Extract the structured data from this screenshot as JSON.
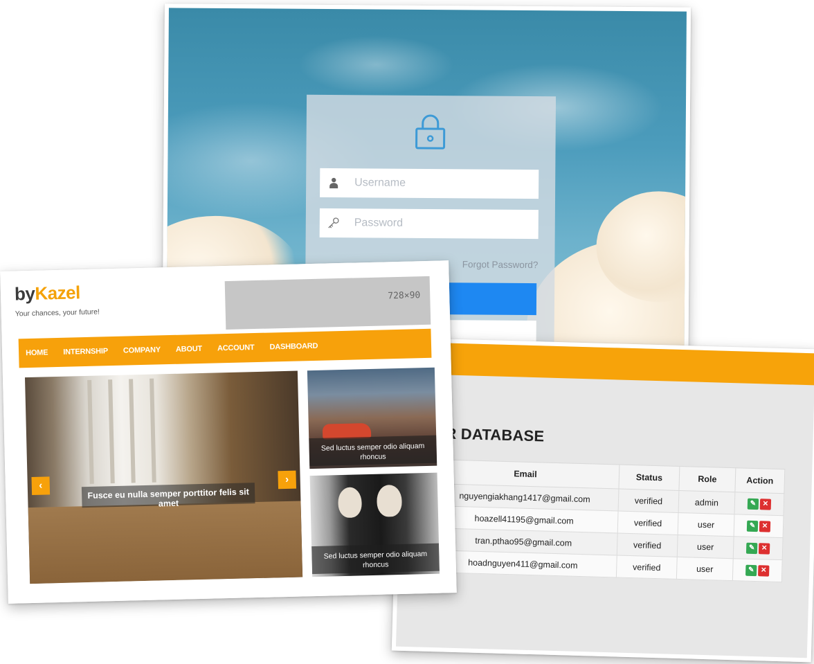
{
  "login": {
    "username_placeholder": "Username",
    "password_placeholder": "Password",
    "forgot_password": "Forgot Password?"
  },
  "database": {
    "title": "ER DATABASE",
    "columns": [
      "Email",
      "Status",
      "Role",
      "Action"
    ],
    "rows": [
      {
        "email": "nguyengiakhang1417@gmail.com",
        "status": "verified",
        "role": "admin"
      },
      {
        "email": "hoazell41195@gmail.com",
        "status": "verified",
        "role": "user"
      },
      {
        "email": "tran.pthao95@gmail.com",
        "status": "verified",
        "role": "user"
      },
      {
        "email": "hoadnguyen411@gmail.com",
        "status": "verified",
        "role": "user"
      }
    ]
  },
  "site": {
    "logo_by": "by",
    "logo_brand": "Kazel",
    "tagline": "Your chances, your future!",
    "ad_label": "728×90",
    "nav": [
      "HOME",
      "INTERNSHIP",
      "COMPANY",
      "ABOUT",
      "ACCOUNT",
      "DASHBOARD"
    ],
    "slide_caption": "Fusce eu nulla semper porttitor felis sit amet",
    "thumb_captions": [
      "Sed luctus semper odio aliquam rhoncus",
      "Sed luctus semper odio aliquam rhoncus"
    ],
    "prev_arrow": "‹",
    "next_arrow": "›"
  },
  "colors": {
    "accent_orange": "#f7a10b",
    "login_button_blue": "#1e88f2",
    "edit_green": "#34a853",
    "delete_red": "#dd3030"
  },
  "icons": {
    "lock": "lock-icon",
    "user": "user-icon",
    "key": "key-icon",
    "edit": "pencil-icon",
    "delete": "close-icon"
  }
}
